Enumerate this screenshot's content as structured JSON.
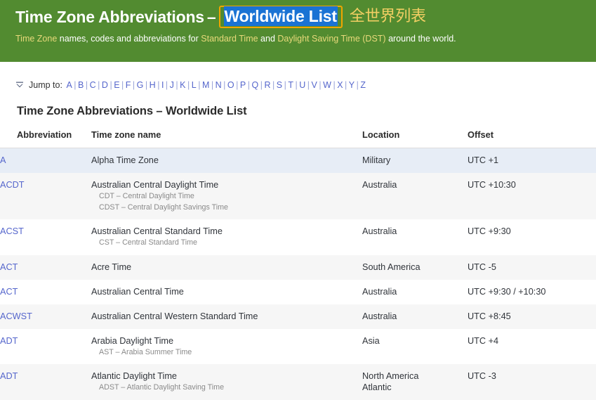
{
  "masthead": {
    "title_prefix": "Time Zone Abbreviations",
    "dash": "–",
    "title_selected": "Worldwide List",
    "title_cn": "全世界列表",
    "subtitle": {
      "s1": "Time Zone",
      "s2": " names, codes and abbreviations for ",
      "s3": "Standard Time",
      "s4": " and ",
      "s5": "Daylight Saving Time (DST)",
      "s6": " around the world."
    },
    "colors": {
      "background": "#528b30",
      "selection_highlight": "#1a73d4",
      "selection_border": "#f0a500",
      "link_gold": "#e8d97a",
      "chinese_gold": "#f2cf63"
    }
  },
  "jumpbar": {
    "icon": "jump-down-icon",
    "label": "Jump to:",
    "letters": [
      "A",
      "B",
      "C",
      "D",
      "E",
      "F",
      "G",
      "H",
      "I",
      "J",
      "K",
      "L",
      "M",
      "N",
      "O",
      "P",
      "Q",
      "R",
      "S",
      "T",
      "U",
      "V",
      "W",
      "X",
      "Y",
      "Z"
    ],
    "separator": "|",
    "link_color": "#5566cc"
  },
  "section": {
    "title": "Time Zone Abbreviations – Worldwide List"
  },
  "table": {
    "headers": [
      "Abbreviation",
      "Time zone name",
      "Location",
      "Offset"
    ],
    "rows": [
      {
        "abbr": "A",
        "name": "Alpha Time Zone",
        "aliases": [],
        "location": "Military",
        "location_sub": "",
        "offset": "UTC +1",
        "style": "selected"
      },
      {
        "abbr": "ACDT",
        "name": "Australian Central Daylight Time",
        "aliases": [
          "CDT – Central Daylight Time",
          "CDST – Central Daylight Savings Time"
        ],
        "location": "Australia",
        "location_sub": "",
        "offset": "UTC +10:30",
        "style": "even"
      },
      {
        "abbr": "ACST",
        "name": "Australian Central Standard Time",
        "aliases": [
          "CST – Central Standard Time"
        ],
        "location": "Australia",
        "location_sub": "",
        "offset": "UTC +9:30",
        "style": "odd"
      },
      {
        "abbr": "ACT",
        "name": "Acre Time",
        "aliases": [],
        "location": "South America",
        "location_sub": "",
        "offset": "UTC -5",
        "style": "even"
      },
      {
        "abbr": "ACT",
        "name": "Australian Central Time",
        "aliases": [],
        "location": "Australia",
        "location_sub": "",
        "offset": "UTC +9:30 / +10:30",
        "style": "odd"
      },
      {
        "abbr": "ACWST",
        "name": "Australian Central Western Standard Time",
        "aliases": [],
        "location": "Australia",
        "location_sub": "",
        "offset": "UTC +8:45",
        "style": "even"
      },
      {
        "abbr": "ADT",
        "name": "Arabia Daylight Time",
        "aliases": [
          "AST – Arabia Summer Time"
        ],
        "location": "Asia",
        "location_sub": "",
        "offset": "UTC +4",
        "style": "odd"
      },
      {
        "abbr": "ADT",
        "name": "Atlantic Daylight Time",
        "aliases": [
          "ADST – Atlantic Daylight Saving Time"
        ],
        "location": "North America",
        "location_sub": "Atlantic",
        "offset": "UTC -3",
        "style": "even"
      }
    ]
  }
}
